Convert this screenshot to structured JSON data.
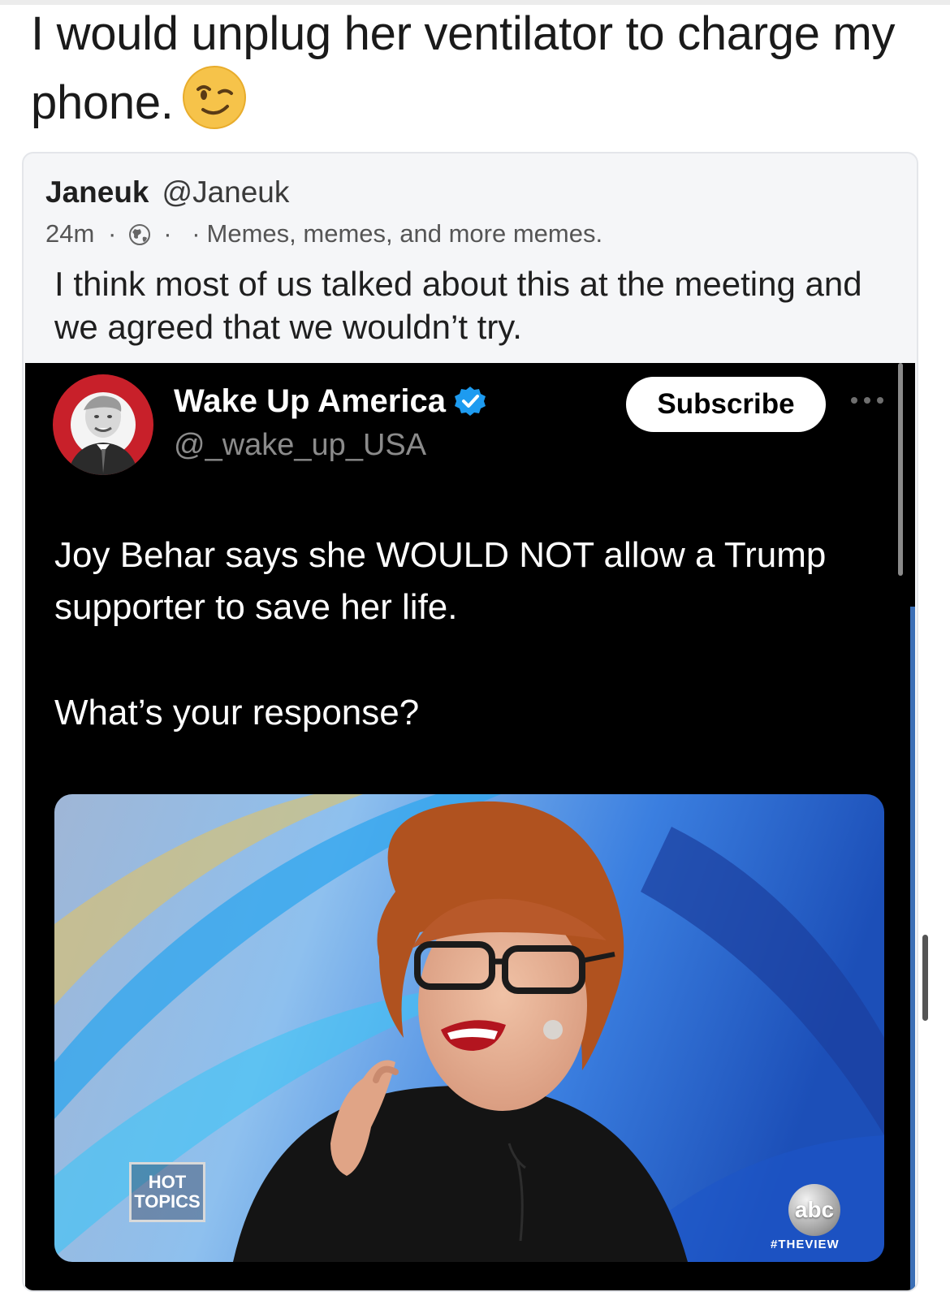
{
  "post": {
    "text": "I would unplug her ventilator to charge my phone.",
    "emoji": "winking-face"
  },
  "quote": {
    "author_name": "Janeuk",
    "author_handle": "@Janeuk",
    "time": "24m",
    "dot": "·",
    "dot2": "·",
    "dot3": "·",
    "visibility_icon": "globe-icon",
    "group_name": "Memes, memes, and more memes.",
    "body": "I think most of us talked about this at the meeting and we agreed that we wouldn’t try."
  },
  "embed": {
    "account_name": "Wake Up America",
    "account_handle": "@_wake_up_USA",
    "subscribe_label": "Subscribe",
    "tweet_line1": "Joy Behar says she WOULD NOT allow a Trump supporter to save her life.",
    "tweet_line2": "What’s your response?",
    "media": {
      "hot_topics": "HOT TOPICS",
      "network_logo": "abc",
      "hashtag": "#THEVIEW"
    }
  },
  "colors": {
    "verified": "#1d9bf0",
    "embed_bg": "#000000",
    "card_bg": "#f5f6f8"
  }
}
